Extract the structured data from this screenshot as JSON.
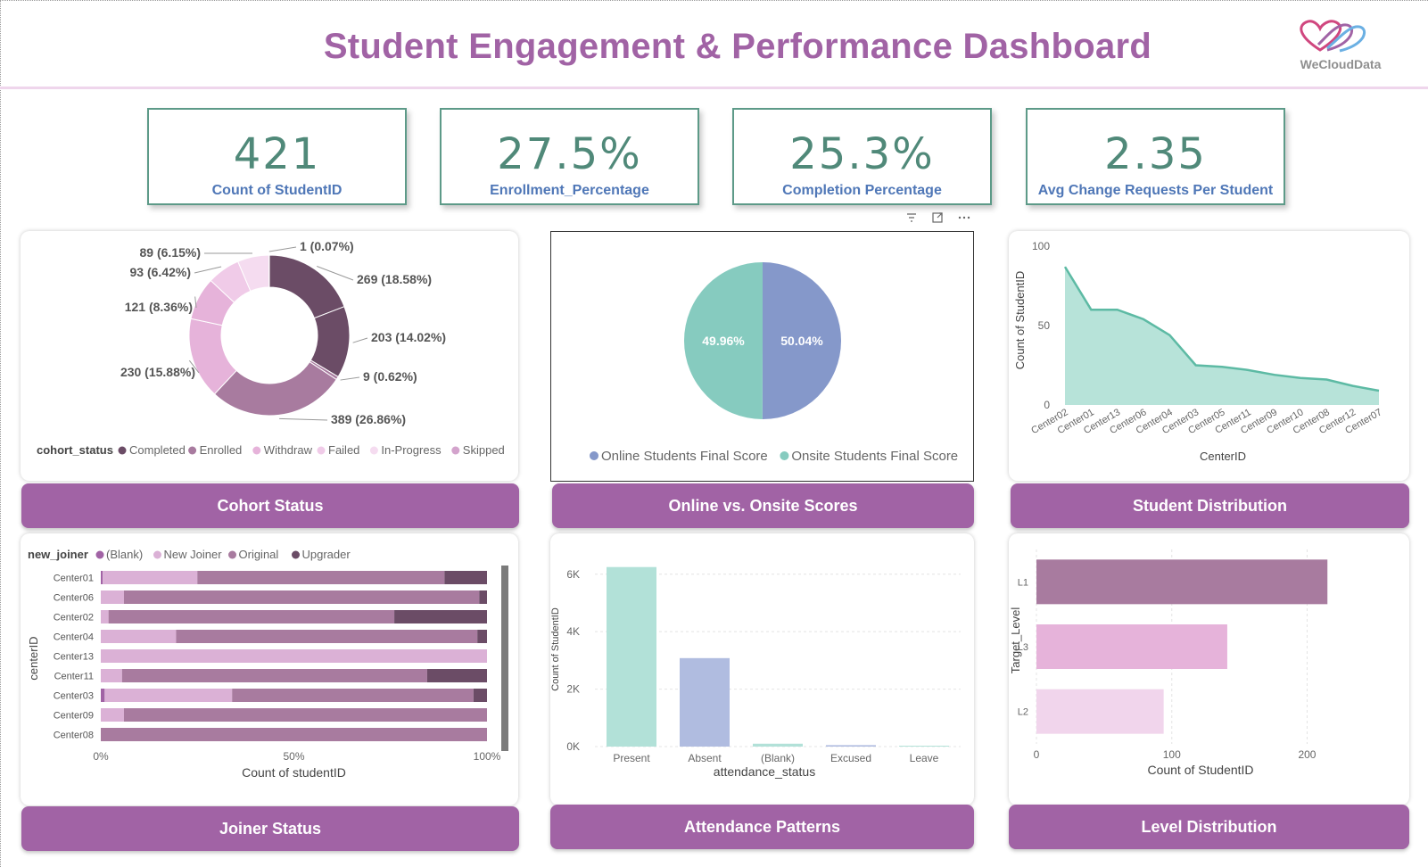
{
  "header": {
    "title": "Student Engagement & Performance Dashboard",
    "logo_text": "WeCloudData",
    "logo_icon": "heart-waves-logo"
  },
  "kpis": [
    {
      "value": "421",
      "label": "Count of StudentID"
    },
    {
      "value": "27.5%",
      "label": "Enrollment_Percentage"
    },
    {
      "value": "25.3%",
      "label": "Completion Percentage"
    },
    {
      "value": "2.35",
      "label": "Avg Change Requests Per Student"
    }
  ],
  "toolbar": {
    "icons": [
      "filter-icon",
      "focus-mode-icon",
      "more-options-icon"
    ]
  },
  "captions": {
    "cohort": "Cohort Status",
    "online": "Online vs. Onsite Scores",
    "distribution": "Student Distribution",
    "joiner": "Joiner Status",
    "attendance": "Attendance Patterns",
    "level": "Level Distribution"
  },
  "colors": {
    "accent": "#a163a5",
    "kpi_value": "#508979",
    "kpi_label": "#4f77b7",
    "kpi_border": "#5d9a88"
  },
  "chart_data": [
    {
      "id": "cohort",
      "type": "pie",
      "donut": true,
      "legend_title": "cohort_status",
      "legend_position": "bottom",
      "slices": [
        {
          "name": "Completed",
          "value": 269,
          "label": "269 (18.58%)",
          "color": "#6b4c66"
        },
        {
          "name": "Completed",
          "value": 203,
          "label": "203 (14.02%)",
          "color": "#6b4c66"
        },
        {
          "name": "Enrolled",
          "value": 9,
          "label": "9 (0.62%)",
          "color": "#a87b9f"
        },
        {
          "name": "Enrolled",
          "value": 389,
          "label": "389 (26.86%)",
          "color": "#a87b9f"
        },
        {
          "name": "Withdraw",
          "value": 230,
          "label": "230 (15.88%)",
          "color": "#e6b3da"
        },
        {
          "name": "Withdraw",
          "value": 121,
          "label": "121 (8.36%)",
          "color": "#e6b3da"
        },
        {
          "name": "Failed",
          "value": 93,
          "label": "93 (6.42%)",
          "color": "#f0cbe8"
        },
        {
          "name": "In-Progress",
          "value": 89,
          "label": "89 (6.15%)",
          "color": "#f5dcf0"
        },
        {
          "name": "Skipped",
          "value": 1,
          "label": "1 (0.07%)",
          "color": "#d3a3cc"
        }
      ],
      "legend": [
        {
          "name": "Completed",
          "color": "#6b4c66"
        },
        {
          "name": "Enrolled",
          "color": "#a87b9f"
        },
        {
          "name": "Withdraw",
          "color": "#e6b3da"
        },
        {
          "name": "Failed",
          "color": "#f0cbe8"
        },
        {
          "name": "In-Progress",
          "color": "#f5dcf0"
        },
        {
          "name": "Skipped",
          "color": "#d3a3cc"
        }
      ]
    },
    {
      "id": "online",
      "type": "pie",
      "legend_position": "bottom",
      "slices": [
        {
          "name": "Online Students Final Score",
          "value": 50.04,
          "label": "50.04%",
          "color": "#8598ca"
        },
        {
          "name": "Onsite Students Final Score",
          "value": 49.96,
          "label": "49.96%",
          "color": "#86cbbf"
        }
      ]
    },
    {
      "id": "distribution",
      "type": "area",
      "xlabel": "CenterID",
      "ylabel": "Count of StudentID",
      "ylim": [
        0,
        100
      ],
      "yticks": [
        0,
        50,
        100
      ],
      "categories": [
        "Center02",
        "Center01",
        "Center13",
        "Center06",
        "Center04",
        "Center03",
        "Center05",
        "Center11",
        "Center09",
        "Center10",
        "Center08",
        "Center12",
        "Center07"
      ],
      "values": [
        87,
        60,
        60,
        54,
        44,
        25,
        24,
        22,
        19,
        17,
        16,
        12,
        9
      ],
      "color": "#5dbaa4",
      "fill": "#b7e3d9"
    },
    {
      "id": "joiner",
      "type": "bar",
      "orientation": "horizontal",
      "stacked": "100%",
      "legend_title": "new_joiner",
      "legend_position": "top-left",
      "xlabel": "Count of studentID",
      "ylabel": "centerID",
      "xticks": [
        "0%",
        "50%",
        "100%"
      ],
      "categories": [
        "Center01",
        "Center06",
        "Center02",
        "Center04",
        "Center13",
        "Center11",
        "Center03",
        "Center09",
        "Center08"
      ],
      "series": [
        {
          "name": "(Blank)",
          "color": "#a163a5",
          "values": [
            0.5,
            0,
            0,
            0,
            0,
            0,
            1,
            0,
            0
          ]
        },
        {
          "name": "New Joiner",
          "color": "#dbb1d6",
          "values": [
            24.5,
            6,
            2,
            19.5,
            100,
            5.5,
            33,
            6,
            0
          ]
        },
        {
          "name": "Original",
          "color": "#a87b9f",
          "values": [
            64,
            92,
            74,
            78,
            0,
            79,
            62.5,
            94,
            100
          ]
        },
        {
          "name": "Upgrader",
          "color": "#6b4c66",
          "values": [
            11,
            2,
            24,
            2.5,
            0,
            15.5,
            3.5,
            0,
            0
          ]
        }
      ]
    },
    {
      "id": "attendance",
      "type": "bar",
      "xlabel": "attendance_status",
      "ylabel": "Count of StudentID",
      "ylim": [
        0,
        6800
      ],
      "yticks": [
        "0K",
        "2K",
        "4K",
        "6K"
      ],
      "categories": [
        "Present",
        "Absent",
        "(Blank)",
        "Excused",
        "Leave"
      ],
      "values": [
        6250,
        3080,
        100,
        50,
        30
      ],
      "colors": [
        "#b2e1d8",
        "#b0bce0",
        "#b2e1d8",
        "#b0bce0",
        "#b2e1d8"
      ]
    },
    {
      "id": "level",
      "type": "bar",
      "orientation": "horizontal",
      "xlabel": "Count of StudentID",
      "ylabel": "Target_Level",
      "xlim": [
        0,
        230
      ],
      "xticks": [
        0,
        100,
        200
      ],
      "categories": [
        "L1",
        "L3",
        "L2"
      ],
      "values": [
        215,
        141,
        94
      ],
      "colors": [
        "#a87b9f",
        "#e6b3da",
        "#f1d5ec"
      ]
    }
  ]
}
